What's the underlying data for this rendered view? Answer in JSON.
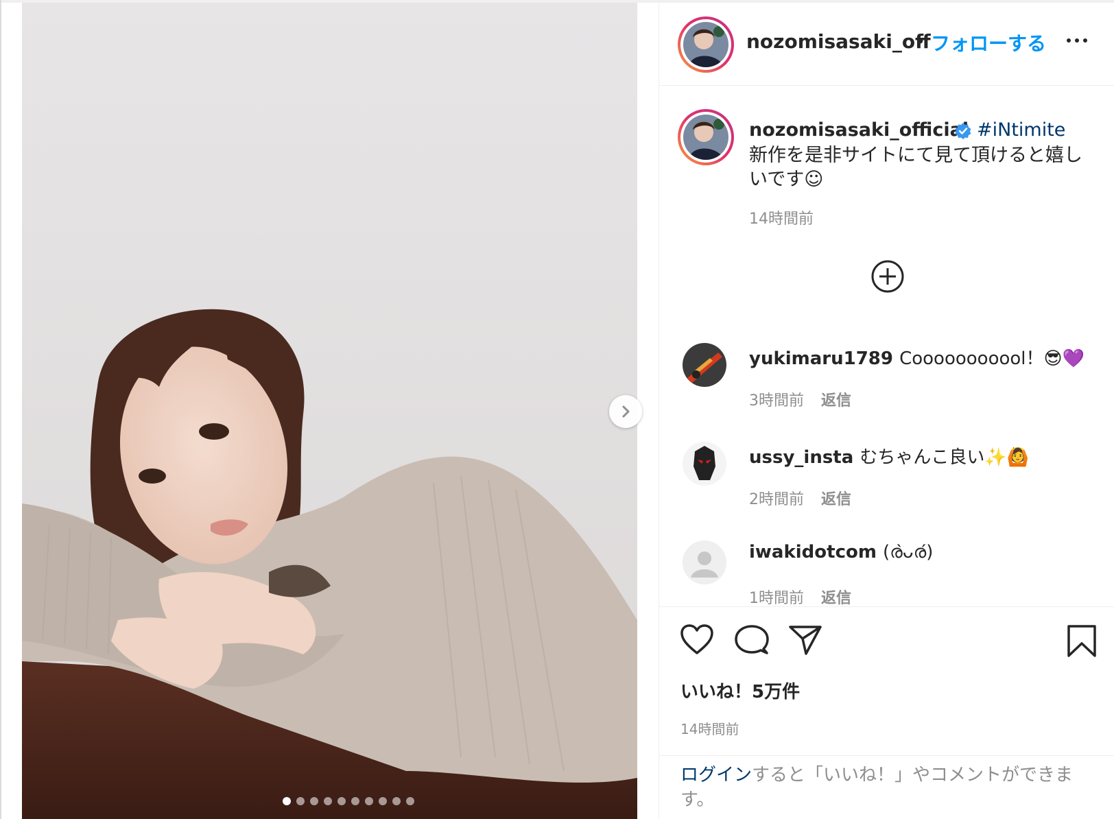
{
  "header": {
    "username": "nozomisasaki_off",
    "separator": "•",
    "follow_label": "フォローする"
  },
  "caption": {
    "username": "nozomisasaki_official",
    "hashtag": "#iNtimite",
    "text": "新作を是非サイトにて見て頂けると嬉しいです☺︎",
    "time": "14時間前"
  },
  "comments": [
    {
      "username": "yukimaru1789",
      "text": "Cooooooooool！😎💜",
      "time": "3時間前",
      "reply": "返信"
    },
    {
      "username": "ussy_insta",
      "text": "むちゃんこ良い✨🙆",
      "time": "2時間前",
      "reply": "返信"
    },
    {
      "username": "iwakidotcom",
      "text": "(ര̀ᴗര́)",
      "time": "1時間前",
      "reply": "返信"
    }
  ],
  "likes": "いいね！5万件",
  "post_time": "14時間前",
  "login_prompt": {
    "link": "ログイン",
    "rest": "すると「いいね！」やコメントができます。"
  },
  "carousel": {
    "slide_count": 10,
    "active_index": 0
  },
  "colors": {
    "link_blue": "#0095f6",
    "hashtag_blue": "#00376b",
    "muted": "#8e8e8e",
    "text": "#262626"
  },
  "icons": [
    "more-icon",
    "verified-icon",
    "add-comment-icon",
    "heart-icon",
    "comment-icon",
    "share-icon",
    "bookmark-icon",
    "chevron-right-icon"
  ]
}
